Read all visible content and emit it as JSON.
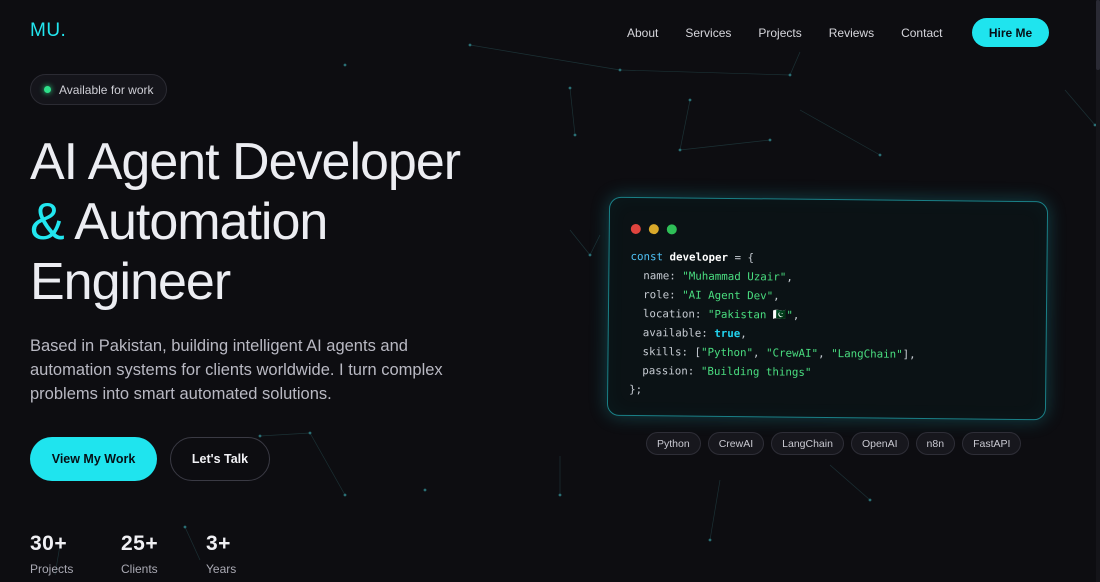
{
  "brand": {
    "logo": "MU."
  },
  "nav": {
    "items": [
      "About",
      "Services",
      "Projects",
      "Reviews",
      "Contact"
    ],
    "cta": "Hire Me"
  },
  "hero": {
    "badge": "Available for work",
    "title_line1": "AI Agent Developer",
    "title_amp": "&",
    "title_line2": "Automation",
    "title_line3": "Engineer",
    "subtitle": "Based in Pakistan, building intelligent AI agents and automation systems for clients worldwide. I turn complex problems into smart automated solutions.",
    "primary_button": "View My Work",
    "secondary_button": "Let's Talk"
  },
  "stats": [
    {
      "value": "30+",
      "label": "Projects"
    },
    {
      "value": "25+",
      "label": "Clients"
    },
    {
      "value": "3+",
      "label": "Years"
    }
  ],
  "code_card": {
    "keyword": "const",
    "var_name": "developer",
    "open": " = {",
    "fields": [
      {
        "key": "name",
        "value": "\"Muhammad Uzair\"",
        "type": "string",
        "suffix": ","
      },
      {
        "key": "role",
        "value": "\"AI Agent Dev\"",
        "type": "string",
        "suffix": ","
      },
      {
        "key": "location",
        "value": "\"Pakistan 🇵🇰\"",
        "type": "string",
        "suffix": ","
      },
      {
        "key": "available",
        "value": "true",
        "type": "bool",
        "suffix": ","
      },
      {
        "key": "skills",
        "value": "[\"Python\", \"CrewAI\", \"LangChain\"]",
        "type": "array",
        "suffix": ","
      },
      {
        "key": "passion",
        "value": "\"Building things\"",
        "type": "string",
        "suffix": ""
      }
    ],
    "close": "};"
  },
  "tags": [
    "Python",
    "CrewAI",
    "LangChain",
    "OpenAI",
    "n8n",
    "FastAPI"
  ],
  "colors": {
    "accent": "#1fe4ee",
    "background": "#0d0d11",
    "status_dot": "#2ee08a"
  },
  "icons": {
    "status": "status-dot-icon",
    "window_controls": [
      "close-dot-icon",
      "minimize-dot-icon",
      "maximize-dot-icon"
    ]
  }
}
